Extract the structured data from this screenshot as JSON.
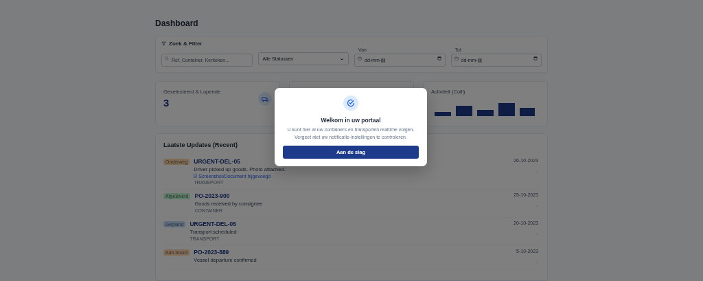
{
  "page": {
    "title": "Dashboard"
  },
  "filter": {
    "title": "Zoek & Filter",
    "search": {
      "placeholder": "Ref, Container, Kenteken..."
    },
    "status_select": {
      "value": "Alle Statussen"
    },
    "dates": [
      {
        "label": "Van",
        "placeholder": "dd-mm-jjjj"
      },
      {
        "label": "Tot",
        "placeholder": "dd-mm-jjjj"
      }
    ]
  },
  "stats": [
    {
      "kind": "count",
      "label": "Geselecteerd & Lopende",
      "value": "3"
    },
    {
      "kind": "covered"
    },
    {
      "kind": "activity",
      "label": "Activiteit (Colli)"
    }
  ],
  "updates": {
    "title": "Laatste Updates (Recent)",
    "rows": [
      {
        "status": "Onderweg",
        "color": "#7f6b55",
        "reference": "URGENT-DEL-05",
        "message": "Driver picked up goods. Photo attached.",
        "attachment": "Screenshot/Document bijgevoegd",
        "category": "TRANSPORT",
        "date": "26-10-2023"
      },
      {
        "status": "Afgeleverd",
        "color": "#5e7b68",
        "reference": "PO-2023-900",
        "message": "Goods received by consignee",
        "category": "CONTAINER",
        "date": "25-10-2023"
      },
      {
        "status": "Gepland",
        "color": "#606d7f",
        "reference": "URGENT-DEL-05",
        "message": "Transport scheduled",
        "category": "TRANSPORT",
        "date": "20-10-2023"
      },
      {
        "status": "Aan boord",
        "color": "#7f6b55",
        "reference": "PO-2023-889",
        "message": "Vessel departure confirmed",
        "date": "5-10-2023"
      }
    ]
  },
  "modal": {
    "title": "Welkom in uw portaal",
    "lines": [
      "U kunt hier al uw containers en transporten realtime volgen.",
      "Vergeet niet uw notificatie-instellingen te controleren."
    ],
    "button": "Aan de slag"
  }
}
